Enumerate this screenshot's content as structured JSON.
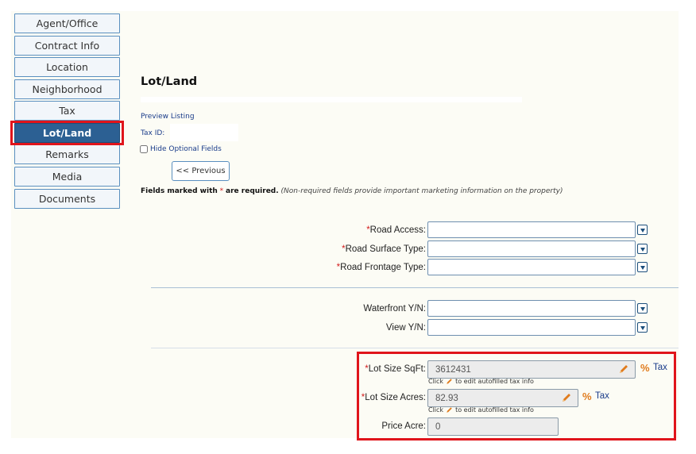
{
  "nav": {
    "items": [
      {
        "label": "Agent/Office",
        "active": false
      },
      {
        "label": "Contract Info",
        "active": false
      },
      {
        "label": "Location",
        "active": false
      },
      {
        "label": "Neighborhood",
        "active": false
      },
      {
        "label": "Tax",
        "active": false
      },
      {
        "label": "Lot/Land",
        "active": true
      },
      {
        "label": "Remarks",
        "active": false
      },
      {
        "label": "Media",
        "active": false
      },
      {
        "label": "Documents",
        "active": false
      }
    ]
  },
  "page": {
    "title": "Lot/Land",
    "preview_link": "Preview Listing",
    "tax_id_label": "Tax ID:",
    "tax_id_value": "",
    "hide_optional_label": "Hide Optional Fields",
    "hide_optional_checked": false,
    "previous_button": "<< Previous",
    "required_note": {
      "bold_prefix": "Fields marked with",
      "star": "*",
      "bold_suffix": "are required.",
      "italic": "(Non-required fields provide important marketing information on the property)"
    }
  },
  "fields": {
    "road_access": {
      "star": "*",
      "label": "Road Access:",
      "value": ""
    },
    "road_surface_type": {
      "star": "*",
      "label": "Road Surface Type:",
      "value": ""
    },
    "road_frontage_type": {
      "star": "*",
      "label": "Road Frontage Type:",
      "value": ""
    },
    "waterfront": {
      "label": "Waterfront Y/N:",
      "value": ""
    },
    "view": {
      "label": "View Y/N:",
      "value": ""
    },
    "lot_size_sqft": {
      "star": "*",
      "label": "Lot Size SqFt:",
      "value": "3612431",
      "pct": "%",
      "tax_link": "Tax",
      "note_before": "Click",
      "note_after": "to edit autofilled tax info"
    },
    "lot_size_acres": {
      "star": "*",
      "label": "Lot Size Acres:",
      "value": "82.93",
      "pct": "%",
      "tax_link": "Tax",
      "note_before": "Click",
      "note_after": "to edit autofilled tax info"
    },
    "price_acre": {
      "label": "Price Acre:",
      "value": "0"
    }
  },
  "colors": {
    "nav_active_bg": "#2c6093",
    "nav_border": "#5a8fbf",
    "required_star": "#d21c1c",
    "highlight_box": "#e0141b",
    "link": "#1a3c8a",
    "pencil": "#e07b1c"
  },
  "icons": {
    "dropdown": "chevron-down-icon",
    "edit": "pencil-icon"
  }
}
